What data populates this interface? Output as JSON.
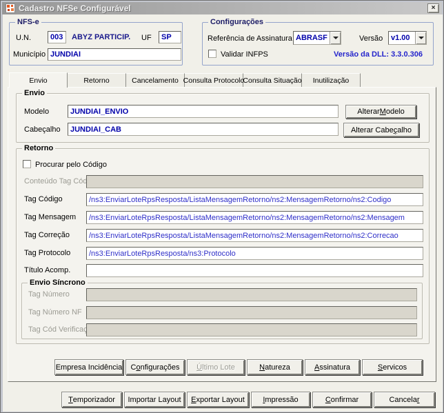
{
  "window": {
    "title": "Cadastro NFSe Configurável",
    "close_glyph": "×"
  },
  "nfse_group": {
    "title": "NFS-e",
    "un_label": "U.N.",
    "un_value": "003",
    "company": "ABYZ PARTICIP.",
    "uf_label": "UF",
    "uf_value": "SP",
    "municipio_label": "Município",
    "municipio_value": "JUNDIAI"
  },
  "config_group": {
    "title": "Configurações",
    "ref_assinatura_label": "Referência de Assinatura",
    "ref_assinatura_value": "ABRASF",
    "versao_label": "Versão",
    "versao_value": "v1.00",
    "validar_infps_label": "Validar INFPS",
    "dll_version": "Versão da DLL: 3.3.0.306"
  },
  "tabs": [
    {
      "label": "Envio"
    },
    {
      "label": "Retorno"
    },
    {
      "label": "Cancelamento"
    },
    {
      "label": "Consulta Protocolo"
    },
    {
      "label": "Consulta Situação"
    },
    {
      "label": "Inutilização"
    }
  ],
  "envio_group": {
    "title": "Envio",
    "modelo_label": "Modelo",
    "modelo_value": "JUNDIAI_ENVIO",
    "cabecalho_label": "Cabeçalho",
    "cabecalho_value": "JUNDIAI_CAB",
    "alterar_modelo": {
      "pre": "Alterar ",
      "accel": "M",
      "post": "odelo"
    },
    "alterar_cabecalho": {
      "pre": "Alterar Cabe",
      "accel": "ç",
      "post": "alho"
    }
  },
  "retorno_group": {
    "title": "Retorno",
    "procurar_label": "Procurar pelo Código",
    "rows": [
      {
        "label": "Conteúdo Tag Código",
        "value": ""
      },
      {
        "label": "Tag Código",
        "value": "/ns3:EnviarLoteRpsResposta/ListaMensagemRetorno/ns2:MensagemRetorno/ns2:Codigo"
      },
      {
        "label": "Tag Mensagem",
        "value": "/ns3:EnviarLoteRpsResposta/ListaMensagemRetorno/ns2:MensagemRetorno/ns2:Mensagem"
      },
      {
        "label": "Tag Correção",
        "value": "/ns3:EnviarLoteRpsResposta/ListaMensagemRetorno/ns2:MensagemRetorno/ns2:Correcao"
      },
      {
        "label": "Tag Protocolo",
        "value": "/ns3:EnviarLoteRpsResposta/ns3:Protocolo"
      },
      {
        "label": "Título Acomp.",
        "value": ""
      }
    ]
  },
  "envio_sincrono_group": {
    "title": "Envio Síncrono",
    "rows": [
      {
        "label": "Tag Número",
        "value": ""
      },
      {
        "label": "Tag Número NF",
        "value": ""
      },
      {
        "label": "Tag Cód Verificação",
        "value": ""
      }
    ]
  },
  "tab_buttons": [
    {
      "pre": "Empresa Incidência",
      "accel": "",
      "post": ""
    },
    {
      "pre": "C",
      "accel": "o",
      "post": "nfigurações"
    },
    {
      "pre": "",
      "accel": "Ú",
      "post": "ltimo Lote"
    },
    {
      "pre": "",
      "accel": "N",
      "post": "atureza"
    },
    {
      "pre": "",
      "accel": "A",
      "post": "ssinatura"
    },
    {
      "pre": "",
      "accel": "S",
      "post": "ervicos"
    }
  ],
  "bottom_buttons": [
    {
      "pre": "",
      "accel": "T",
      "post": "emporizador"
    },
    {
      "pre": "Importar Layout",
      "accel": "",
      "post": ""
    },
    {
      "pre": "",
      "accel": "E",
      "post": "xportar Layout"
    },
    {
      "pre": "",
      "accel": "I",
      "post": "mpressão"
    },
    {
      "pre": "",
      "accel": "C",
      "post": "onfirmar"
    },
    {
      "pre": "Cancela",
      "accel": "r",
      "post": ""
    }
  ],
  "colors": {
    "value_navy": "#0000aa",
    "path_blue": "#2e2ec8",
    "dll_blue": "#2424cc",
    "group_border_blue": "#93a3cb",
    "titlebar_start": "#979797",
    "titlebar_end": "#c9c9c9",
    "dialog_bg": "#f1f0e9"
  }
}
